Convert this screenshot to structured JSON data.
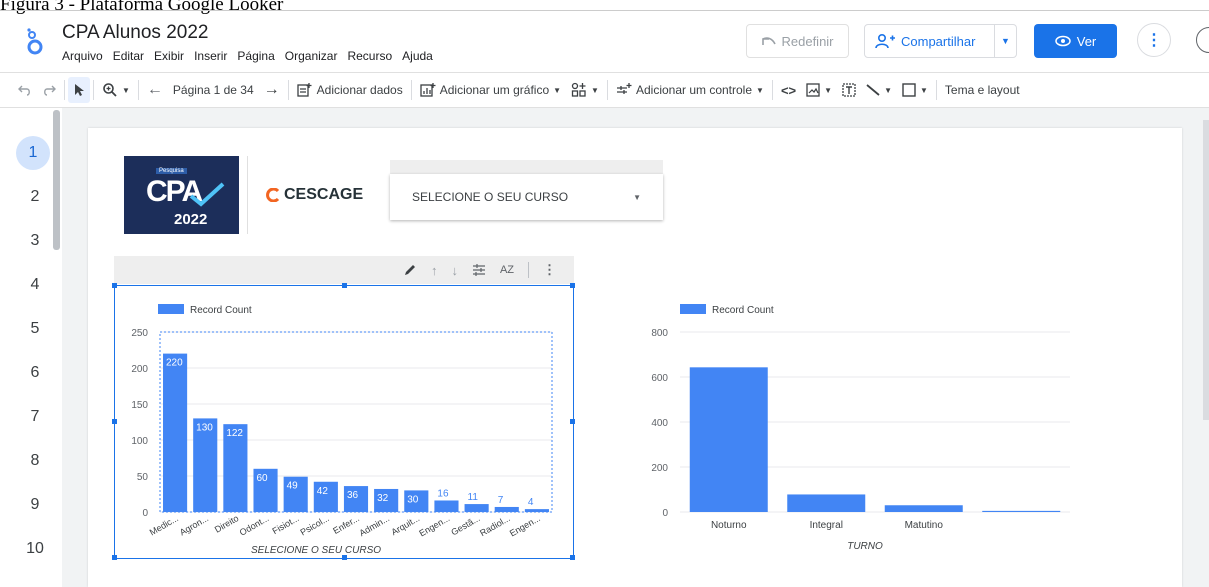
{
  "caption": "Figura 3 - Plataforma Google Looker",
  "app": {
    "title": "CPA Alunos 2022"
  },
  "menu": [
    "Arquivo",
    "Editar",
    "Exibir",
    "Inserir",
    "Página",
    "Organizar",
    "Recurso",
    "Ajuda"
  ],
  "header": {
    "reset_label": "Redefinir",
    "share_label": "Compartilhar",
    "view_label": "Ver"
  },
  "toolbar": {
    "page_indicator": "Página 1 de 34",
    "add_data": "Adicionar dados",
    "add_chart": "Adicionar um gráfico",
    "add_control": "Adicionar um controle",
    "theme": "Tema e layout"
  },
  "pages": [
    "1",
    "2",
    "3",
    "4",
    "5",
    "6",
    "7",
    "8",
    "9",
    "10"
  ],
  "report": {
    "cpa_logo_top": "Pesquisa",
    "cpa_logo_main": "CPA",
    "cpa_logo_year": "2022",
    "cescage": "CESCAGE",
    "dropdown_label": "SELECIONE O SEU CURSO"
  },
  "colors": {
    "accent": "#1a73e8",
    "bar": "#4285f4",
    "logo_bg": "#1c2e5a"
  },
  "chart_data": [
    {
      "type": "bar",
      "legend": "Record Count",
      "categories": [
        "Medic...",
        "Agron...",
        "Direito",
        "Odont...",
        "Fisiot...",
        "Psicol...",
        "Enfer...",
        "Admin...",
        "Arquit...",
        "Engen...",
        "Gestã...",
        "Radiol...",
        "Engen..."
      ],
      "values": [
        220,
        130,
        122,
        60,
        49,
        42,
        36,
        32,
        30,
        16,
        11,
        7,
        4
      ],
      "xlabel": "SELECIONE O SEU CURSO",
      "ylim": [
        0,
        250
      ],
      "yticks": [
        "0",
        "50",
        "100",
        "150",
        "200",
        "250"
      ],
      "data_labels": true,
      "legend_position": "top-left"
    },
    {
      "type": "bar",
      "legend": "Record Count",
      "categories": [
        "Noturno",
        "Integral",
        "Matutino",
        ""
      ],
      "values": [
        643,
        78,
        30,
        5
      ],
      "xlabel": "TURNO",
      "ylim": [
        0,
        800
      ],
      "yticks": [
        "0",
        "200",
        "400",
        "600",
        "800"
      ],
      "data_labels": false,
      "legend_position": "top-left"
    }
  ]
}
